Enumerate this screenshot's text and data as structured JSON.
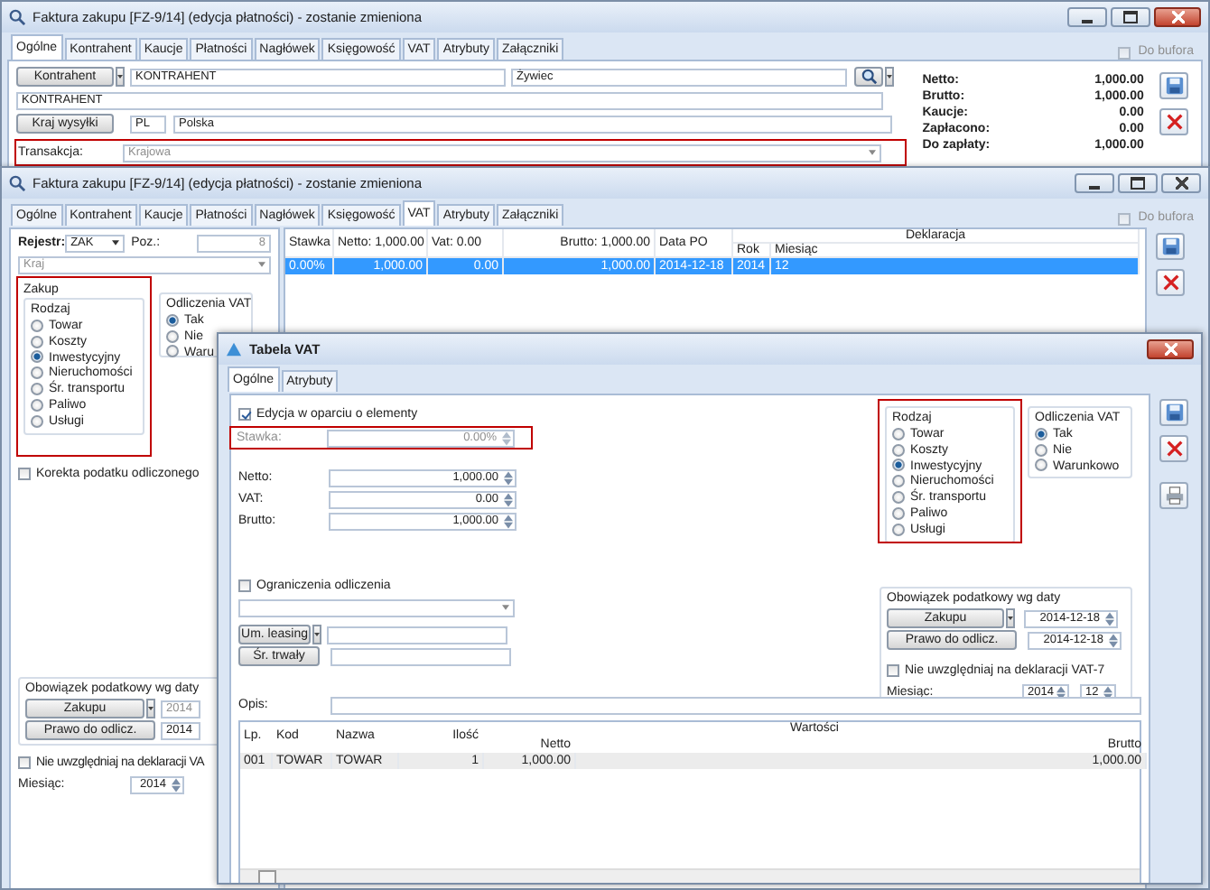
{
  "back_window": {
    "title": "Faktura zakupu [FZ-9/14] (edycja płatności) - zostanie zmieniona",
    "tabs": [
      {
        "label": "Ogólne",
        "selected": true
      },
      {
        "label": "Kontrahent",
        "selected": false
      },
      {
        "label": "Kaucje",
        "selected": false
      },
      {
        "label": "Płatności",
        "selected": false
      },
      {
        "label": "Nagłówek",
        "selected": false
      },
      {
        "label": "Księgowość",
        "selected": false
      },
      {
        "label": "VAT",
        "selected": false
      },
      {
        "label": "Atrybuty",
        "selected": false
      },
      {
        "label": "Załączniki",
        "selected": false
      }
    ],
    "do_bufora": {
      "label": "Do bufora",
      "checked": false
    },
    "kontrahent": {
      "button": "Kontrahent",
      "code": "KONTRAHENT",
      "city": "Żywiec",
      "name": "KONTRAHENT"
    },
    "kraj_wysylki": {
      "button": "Kraj wysyłki",
      "code": "PL",
      "name": "Polska"
    },
    "transakcja": {
      "label": "Transakcja:",
      "value": "Krajowa",
      "highlighted": true
    },
    "totals": [
      {
        "label": "Netto:",
        "value": "1,000.00"
      },
      {
        "label": "Brutto:",
        "value": "1,000.00"
      },
      {
        "label": "Kaucje:",
        "value": "0.00"
      },
      {
        "label": "Zapłacono:",
        "value": "0.00"
      },
      {
        "label": "Do zapłaty:",
        "value": "1,000.00"
      }
    ]
  },
  "invoice_window": {
    "title": "Faktura zakupu [FZ-9/14] (edycja płatności) - zostanie zmieniona",
    "tabs": [
      {
        "label": "Ogólne",
        "selected": false
      },
      {
        "label": "Kontrahent",
        "selected": false
      },
      {
        "label": "Kaucje",
        "selected": false
      },
      {
        "label": "Płatności",
        "selected": false
      },
      {
        "label": "Nagłówek",
        "selected": false
      },
      {
        "label": "Księgowość",
        "selected": false
      },
      {
        "label": "VAT",
        "selected": true
      },
      {
        "label": "Atrybuty",
        "selected": false
      },
      {
        "label": "Załączniki",
        "selected": false
      }
    ],
    "do_bufora": {
      "label": "Do bufora",
      "checked": false
    },
    "rejestr": {
      "label": "Rejestr:",
      "value": "ZAK"
    },
    "poz": {
      "label": "Poz.:",
      "value": "8",
      "disabled": true
    },
    "kraj": {
      "value": "Kraj",
      "disabled": true
    },
    "zakup": {
      "title": "Zakup",
      "highlighted": true,
      "rodzaj_title": "Rodzaj",
      "options": [
        {
          "label": "Towar",
          "selected": false
        },
        {
          "label": "Koszty",
          "selected": false
        },
        {
          "label": "Inwestycyjny",
          "selected": true
        },
        {
          "label": "Nieruchomości",
          "selected": false
        },
        {
          "label": "Śr. transportu",
          "selected": false
        },
        {
          "label": "Paliwo",
          "selected": false
        },
        {
          "label": "Usługi",
          "selected": false
        }
      ]
    },
    "odliczenia": {
      "title": "Odliczenia VAT",
      "options": [
        {
          "label": "Tak",
          "selected": true
        },
        {
          "label": "Nie",
          "selected": false
        },
        {
          "label": "Waru",
          "selected": false
        }
      ]
    },
    "korekta": {
      "label": "Korekta podatku odliczonego",
      "checked": false
    },
    "obowiazek": {
      "title": "Obowiązek podatkowy wg daty",
      "zakupu_button": "Zakupu",
      "zakupu_date": "2014",
      "zakupu_disabled": true,
      "prawo_button": "Prawo do odlicz.",
      "prawo_date": "2014"
    },
    "nie_uwzgledniaj": {
      "label": "Nie uwzględniaj na deklaracji VA",
      "checked": false
    },
    "miesiac": {
      "label": "Miesiąc:",
      "year": "2014"
    },
    "table": {
      "group_header": "Deklaracja",
      "columns": [
        {
          "label": "Stawka"
        },
        {
          "label": "Netto: 1,000.00"
        },
        {
          "label": "Vat: 0.00"
        },
        {
          "label": "Brutto: 1,000.00"
        },
        {
          "label": "Data PO"
        },
        {
          "label": "Rok"
        },
        {
          "label": "Miesiąc"
        }
      ],
      "rows": [
        {
          "selected": true,
          "cells": [
            "0.00%",
            "1,000.00",
            "0.00",
            "1,000.00",
            "2014-12-18",
            "2014",
            "12"
          ]
        }
      ]
    }
  },
  "vat_dialog": {
    "title": "Tabela VAT",
    "tabs": [
      {
        "label": "Ogólne",
        "selected": true
      },
      {
        "label": "Atrybuty",
        "selected": false
      }
    ],
    "edycja": {
      "label": "Edycja w oparciu o elementy",
      "checked": true
    },
    "stawka": {
      "label": "Stawka:",
      "value": "0.00%",
      "disabled": true,
      "highlighted": true
    },
    "amounts": [
      {
        "label": "Netto:",
        "value": "1,000.00"
      },
      {
        "label": "VAT:",
        "value": "0.00"
      },
      {
        "label": "Brutto:",
        "value": "1,000.00"
      }
    ],
    "ograniczenia": {
      "label": "Ograniczenia odliczenia",
      "checked": false
    },
    "um_leasing": {
      "button": "Um. leasing"
    },
    "sr_trwaly": {
      "button": "Śr. trwały"
    },
    "opis": {
      "label": "Opis:"
    },
    "rodzaj": {
      "title": "Rodzaj",
      "highlighted": true,
      "options": [
        {
          "label": "Towar",
          "selected": false
        },
        {
          "label": "Koszty",
          "selected": false
        },
        {
          "label": "Inwestycyjny",
          "selected": true
        },
        {
          "label": "Nieruchomości",
          "selected": false
        },
        {
          "label": "Śr. transportu",
          "selected": false
        },
        {
          "label": "Paliwo",
          "selected": false
        },
        {
          "label": "Usługi",
          "selected": false
        }
      ]
    },
    "odliczenia": {
      "title": "Odliczenia VAT",
      "options": [
        {
          "label": "Tak",
          "selected": true
        },
        {
          "label": "Nie",
          "selected": false
        },
        {
          "label": "Warunkowo",
          "selected": false
        }
      ]
    },
    "obowiazek": {
      "title": "Obowiązek podatkowy wg daty",
      "zakupu_button": "Zakupu",
      "zakupu_date": "2014-12-18",
      "prawo_button": "Prawo do odlicz.",
      "prawo_date": "2014-12-18"
    },
    "nie_uwzgledniaj": {
      "label": "Nie uwzględniaj na deklaracji VAT-7",
      "checked": false
    },
    "miesiac": {
      "label": "Miesiąc:",
      "year": "2014",
      "month": "12"
    },
    "table": {
      "group_header": "Wartości",
      "columns": [
        {
          "label": "Lp."
        },
        {
          "label": "Kod"
        },
        {
          "label": "Nazwa"
        },
        {
          "label": "Ilość"
        },
        {
          "label": "Netto"
        },
        {
          "label": "Brutto"
        }
      ],
      "rows": [
        {
          "selected": false,
          "cells": [
            "001",
            "TOWAR",
            "TOWAR",
            "1",
            "1,000.00",
            "1,000.00"
          ]
        }
      ]
    }
  }
}
